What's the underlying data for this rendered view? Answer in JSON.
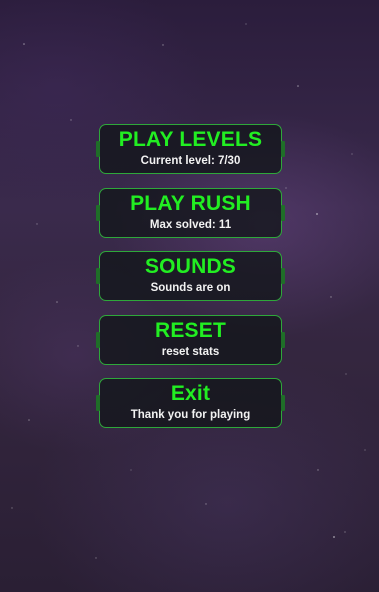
{
  "menu": {
    "items": [
      {
        "title": "PLAY LEVELS",
        "subtitle": "Current level: 7/30"
      },
      {
        "title": "PLAY RUSH",
        "subtitle": "Max solved: 11"
      },
      {
        "title": "SOUNDS",
        "subtitle": "Sounds are on"
      },
      {
        "title": "RESET",
        "subtitle": "reset stats"
      },
      {
        "title": "Exit",
        "subtitle": "Thank you for playing"
      }
    ]
  },
  "colors": {
    "button_title": "#22ee22",
    "button_border": "#2ea83a",
    "button_subtitle": "#f2f2f2",
    "background": "#34263f"
  }
}
